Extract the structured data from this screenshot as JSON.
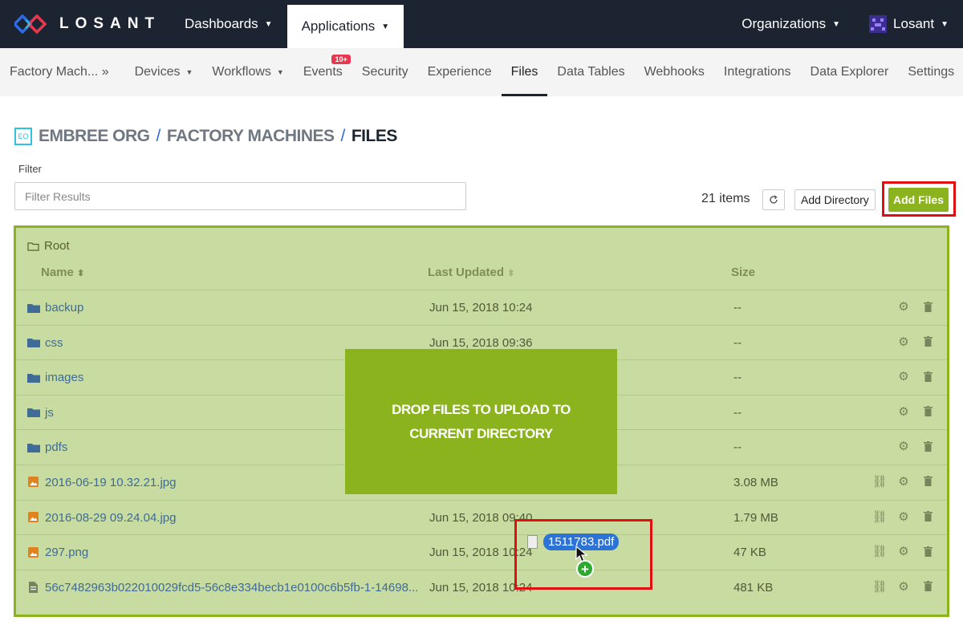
{
  "topnav": {
    "brand": "LOSANT",
    "items": [
      {
        "label": "Dashboards"
      },
      {
        "label": "Applications"
      }
    ],
    "right": [
      {
        "label": "Organizations"
      },
      {
        "label": "Losant"
      }
    ]
  },
  "subnav": {
    "app_label": "Factory Mach... »",
    "items": [
      {
        "label": "Devices"
      },
      {
        "label": "Workflows"
      },
      {
        "label": "Events",
        "badge": "10+"
      },
      {
        "label": "Security"
      },
      {
        "label": "Experience"
      },
      {
        "label": "Files"
      },
      {
        "label": "Data Tables"
      },
      {
        "label": "Webhooks"
      },
      {
        "label": "Integrations"
      },
      {
        "label": "Data Explorer"
      },
      {
        "label": "Settings"
      }
    ]
  },
  "breadcrumb": {
    "org_badge": "EO",
    "org": "EMBREE ORG",
    "app": "FACTORY MACHINES",
    "page": "FILES",
    "sep": "/"
  },
  "filter": {
    "label": "Filter",
    "placeholder": "Filter Results"
  },
  "toolbar": {
    "items_count": "21 items",
    "add_directory": "Add Directory",
    "add_files": "Add Files"
  },
  "table": {
    "root_label": "Root",
    "headers": {
      "name": "Name",
      "updated": "Last Updated",
      "size": "Size"
    },
    "rows": [
      {
        "name": "backup",
        "type": "folder",
        "updated": "Jun 15, 2018 10:24",
        "size": "--"
      },
      {
        "name": "css",
        "type": "folder",
        "updated": "Jun 15, 2018 09:36",
        "size": "--"
      },
      {
        "name": "images",
        "type": "folder",
        "updated": "",
        "size": "--"
      },
      {
        "name": "js",
        "type": "folder",
        "updated": "",
        "size": "--"
      },
      {
        "name": "pdfs",
        "type": "folder",
        "updated": "",
        "size": "--"
      },
      {
        "name": "2016-06-19 10.32.21.jpg",
        "type": "image",
        "updated": "",
        "size": "3.08 MB"
      },
      {
        "name": "2016-08-29 09.24.04.jpg",
        "type": "image",
        "updated": "Jun 15, 2018 09:40",
        "size": "1.79 MB"
      },
      {
        "name": "297.png",
        "type": "image",
        "updated": "Jun 15, 2018 10:24",
        "size": "47 KB"
      },
      {
        "name": "56c7482963b022010029fcd5-56c8e334becb1e0100c6b5fb-1-14698...",
        "type": "doc",
        "updated": "Jun 15, 2018 10:24",
        "size": "481 KB"
      }
    ]
  },
  "drop_overlay": {
    "text": "DROP FILES TO UPLOAD TO CURRENT DIRECTORY"
  },
  "drag": {
    "filename": "1511783.pdf",
    "plus": "+"
  },
  "colors": {
    "topnav_bg": "#1c2331",
    "accent_green": "#8bb31d",
    "highlight_red": "#e01010",
    "link_blue": "#3f6c96",
    "badge_red": "#e8384f"
  }
}
